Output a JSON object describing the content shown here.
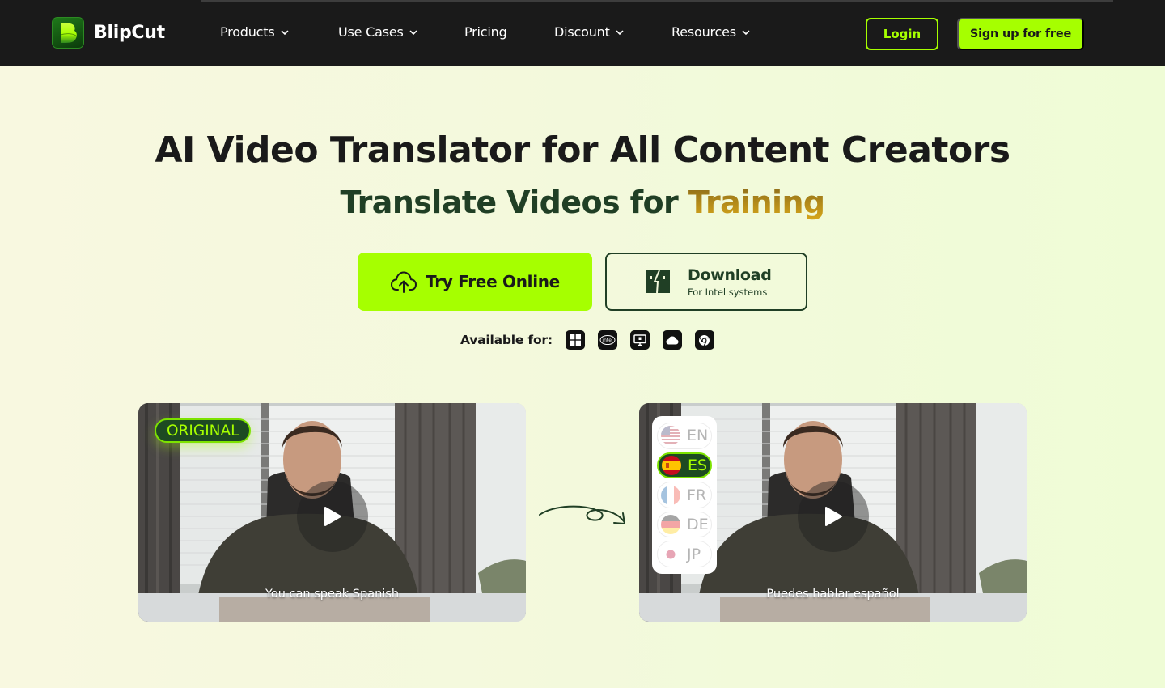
{
  "nav": {
    "brand": "BlipCut",
    "items": [
      {
        "label": "Products",
        "has_dropdown": true
      },
      {
        "label": "Use Cases",
        "has_dropdown": true
      },
      {
        "label": "Pricing",
        "has_dropdown": false
      },
      {
        "label": "Discount",
        "has_dropdown": true
      },
      {
        "label": "Resources",
        "has_dropdown": true
      }
    ],
    "login_label": "Login",
    "signup_label": "Sign up for free"
  },
  "hero": {
    "title": "AI Video Translator for All Content Creators",
    "subtitle_prefix": "Translate Videos for ",
    "subtitle_accent": "Training",
    "try_label": "Try Free Online",
    "download_label": "Download",
    "download_sub": "For Intel systems",
    "available_label": "Available for:",
    "platforms": [
      "windows-icon",
      "intel-icon",
      "desktop-app-icon",
      "cloud-icon",
      "chrome-icon"
    ]
  },
  "demo": {
    "original_badge": "ORIGINAL",
    "original_caption": "You can speak Spanish",
    "translated_caption": "Puedes hablar español",
    "languages": [
      {
        "code": "EN",
        "active": false
      },
      {
        "code": "ES",
        "active": true
      },
      {
        "code": "FR",
        "active": false
      },
      {
        "code": "DE",
        "active": false
      },
      {
        "code": "JP",
        "active": false
      }
    ]
  },
  "colors": {
    "nav_bg": "#1a1a1a",
    "accent": "#a6ff00",
    "dark_green": "#203f25",
    "gold": "#c9991a"
  }
}
